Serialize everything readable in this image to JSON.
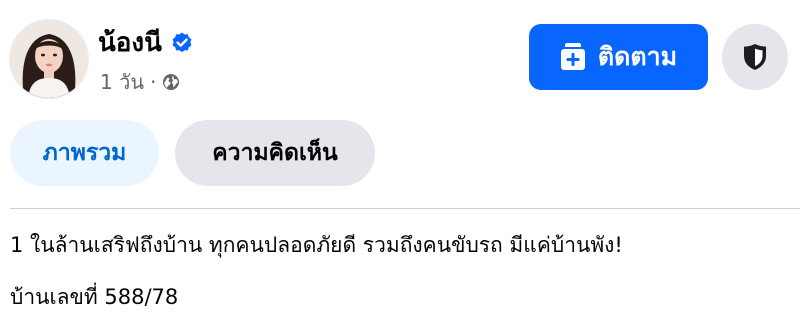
{
  "profile": {
    "name": "น้องนี",
    "time": "1 วัน",
    "separator": "·",
    "verified_icon": "verified-badge-icon",
    "privacy_icon": "globe-icon"
  },
  "actions": {
    "follow_label": "ติดตาม",
    "follow_icon": "follow-page-icon",
    "shield_icon": "shield-icon",
    "accent_color": "#0866ff"
  },
  "tabs": [
    {
      "label": "ภาพรวม",
      "active": true
    },
    {
      "label": "ความคิดเห็น",
      "active": false
    }
  ],
  "post": {
    "line1": "1 ในล้านเสริฟถึงบ้าน ทุกคนปลอดภัยดี รวมถึงคนขับรถ มีแค่บ้านพัง!",
    "line2": "บ้านเลขที่ 588/78"
  }
}
